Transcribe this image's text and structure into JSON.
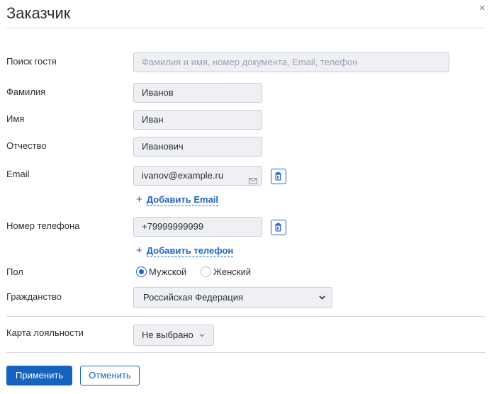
{
  "title": "Заказчик",
  "close_symbol": "×",
  "fields": {
    "guest_search": {
      "label": "Поиск гостя",
      "placeholder": "Фамилия и имя, номер документа, Email, телефон"
    },
    "last_name": {
      "label": "Фамилия",
      "value": "Иванов"
    },
    "first_name": {
      "label": "Имя",
      "value": "Иван"
    },
    "middle_name": {
      "label": "Отчество",
      "value": "Иванович"
    },
    "email": {
      "label": "Email",
      "value": "ivanov@example.ru",
      "add_label": "Добавить Email"
    },
    "phone": {
      "label": "Номер телефона",
      "value": "+79999999999",
      "add_label": "Добавить телефон"
    },
    "gender": {
      "label": "Пол",
      "options": [
        "Мужской",
        "Женский"
      ],
      "selected": "Мужской"
    },
    "citizenship": {
      "label": "Гражданство",
      "value": "Российская Федерация"
    },
    "loyalty_card": {
      "label": "Карта лояльности",
      "value": "Не выбрано"
    }
  },
  "add_symbol": "+",
  "buttons": {
    "apply": "Применить",
    "cancel": "Отменить"
  },
  "icons": {
    "close": "close-icon",
    "mail": "mail-icon",
    "trash": "trash-icon",
    "plus": "plus-icon",
    "chevron": "chevron-down-icon"
  },
  "colors": {
    "accent": "#1562c1",
    "input_bg": "#eef0f3",
    "border": "#c9ced6"
  }
}
